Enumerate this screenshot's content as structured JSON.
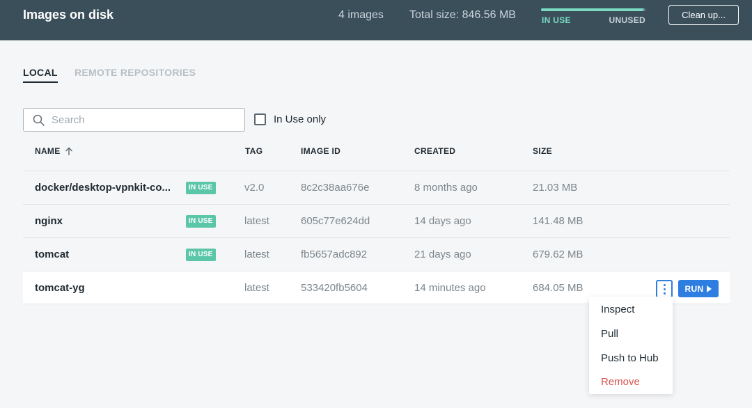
{
  "header": {
    "title": "Images on disk",
    "image_count": "4 images",
    "total_size": "Total size: 846.56 MB",
    "usage": {
      "in_use_label": "IN USE",
      "unused_label": "UNUSED",
      "in_use_fraction": 0.98
    },
    "cleanup_label": "Clean up..."
  },
  "tabs": [
    {
      "label": "LOCAL",
      "active": true
    },
    {
      "label": "REMOTE REPOSITORIES",
      "active": false
    }
  ],
  "search": {
    "placeholder": "Search",
    "value": ""
  },
  "filter": {
    "label": "In Use only",
    "checked": false
  },
  "columns": {
    "name": "NAME",
    "tag": "TAG",
    "image_id": "IMAGE ID",
    "created": "CREATED",
    "size": "SIZE"
  },
  "rows": [
    {
      "name": "docker/desktop-vpnkit-co...",
      "badge": "IN USE",
      "tag": "v2.0",
      "image_id": "8c2c38aa676e",
      "created": "8 months ago",
      "size": "21.03 MB"
    },
    {
      "name": "nginx",
      "badge": "IN USE",
      "tag": "latest",
      "image_id": "605c77e624dd",
      "created": "14 days ago",
      "size": "141.48 MB"
    },
    {
      "name": "tomcat",
      "badge": "IN USE",
      "tag": "latest",
      "image_id": "fb5657adc892",
      "created": "21 days ago",
      "size": "679.62 MB"
    },
    {
      "name": "tomcat-yg",
      "badge": "",
      "tag": "latest",
      "image_id": "533420fb5604",
      "created": "14 minutes ago",
      "size": "684.05 MB"
    }
  ],
  "row_actions": {
    "run_label": "RUN"
  },
  "menu": {
    "items": [
      "Inspect",
      "Pull",
      "Push to Hub",
      "Remove"
    ]
  },
  "colors": {
    "header_bg": "#3b4f5b",
    "accent": "#2e7de0",
    "in_use": "#5cc6a8",
    "danger": "#d9534f"
  }
}
